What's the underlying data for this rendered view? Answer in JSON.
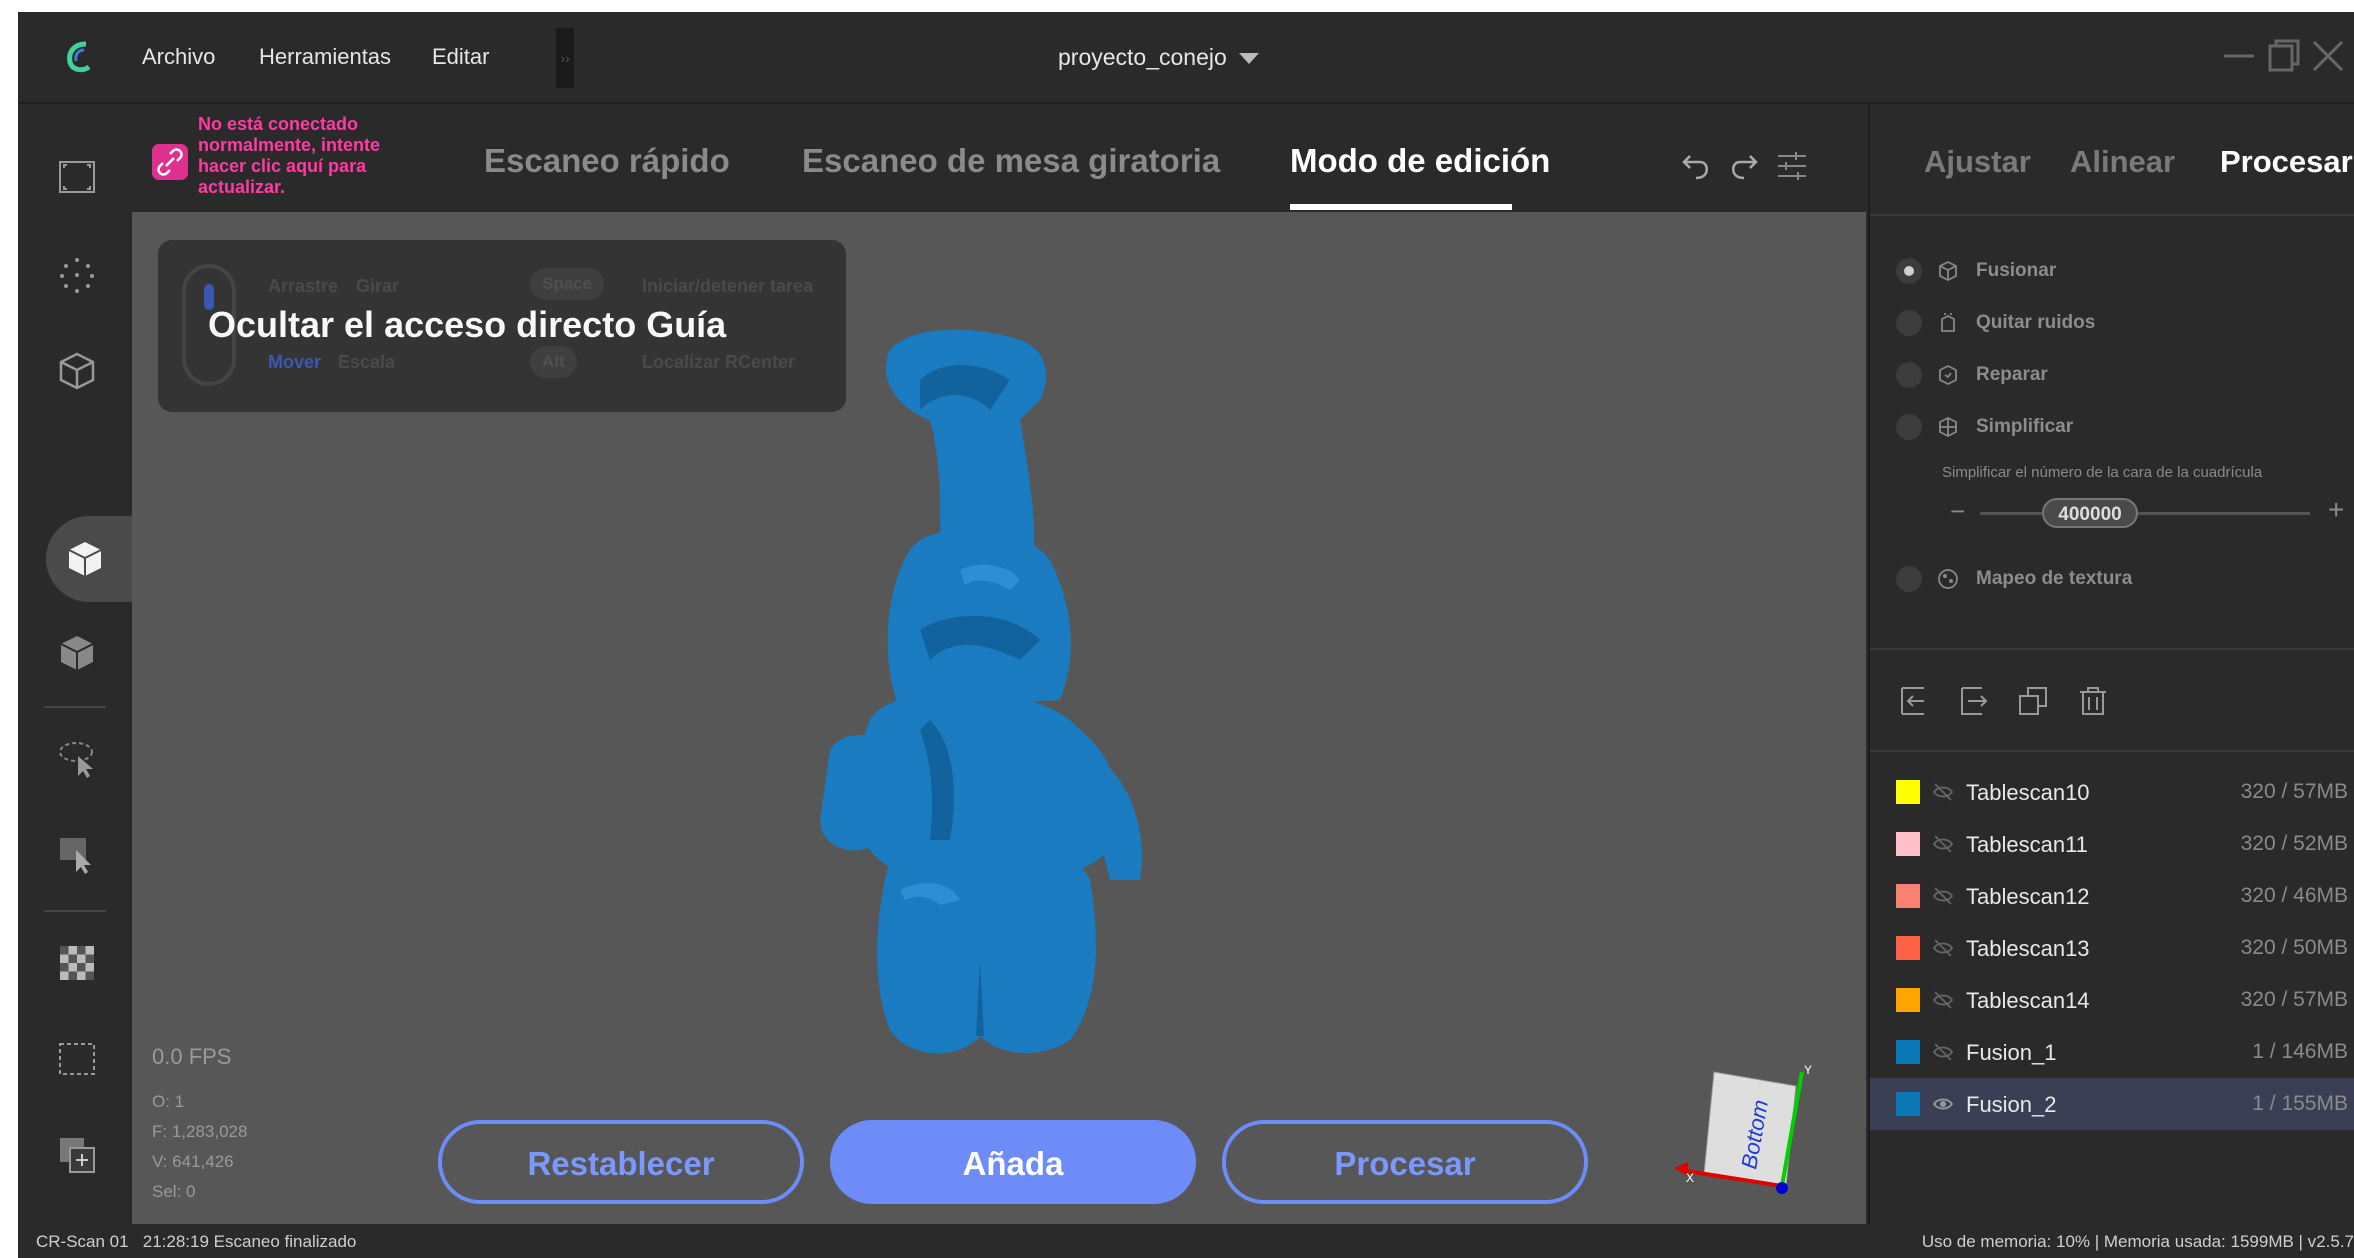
{
  "menu": {
    "archivo": "Archivo",
    "herramientas": "Herramientas",
    "editar": "Editar",
    "collapse": "››"
  },
  "project": {
    "name": "proyecto_conejo"
  },
  "connection": {
    "warning": "No está conectado normalmente, intente hacer clic aquí para actualizar."
  },
  "tabs": [
    {
      "label": "Escaneo rápido"
    },
    {
      "label": "Escaneo de mesa giratoria"
    },
    {
      "label": "Modo de edición"
    }
  ],
  "shortcut_guide": {
    "title": "Ocultar el acceso directo Guía",
    "drag": "Arrastre",
    "rotate": "Girar",
    "move": "Mover",
    "scale": "Escala",
    "space_key": "Space",
    "space_action": "Iniciar/detener tarea",
    "alt_key": "Alt",
    "alt_action": "Localizar RCenter"
  },
  "stats": {
    "fps": "0.0 FPS",
    "o": "O: 1",
    "f": "F: 1,283,028",
    "v": "V: 641,426",
    "sel": "Sel: 0"
  },
  "actions": {
    "reset": "Restablecer",
    "add": "Añada",
    "process": "Procesar"
  },
  "view_cube": {
    "face_label": "Bottom",
    "axis_x": "X",
    "axis_y": "Y"
  },
  "right_tabs": [
    {
      "label": "Ajustar"
    },
    {
      "label": "Alinear"
    },
    {
      "label": "Procesar"
    }
  ],
  "process_options": {
    "fuse": "Fusionar",
    "denoise": "Quitar ruidos",
    "repair": "Reparar",
    "simplify": "Simplificar",
    "simplify_desc": "Simplificar el número de la cara de la cuadrícula",
    "simplify_value": "400000",
    "slider_minus": "−",
    "slider_plus": "+",
    "texture": "Mapeo de textura"
  },
  "scans": [
    {
      "name": "Tablescan10",
      "info": "320 / 57MB",
      "color": "#ffff00"
    },
    {
      "name": "Tablescan11",
      "info": "320 / 52MB",
      "color": "#ffc0cb"
    },
    {
      "name": "Tablescan12",
      "info": "320 / 46MB",
      "color": "#fa8072"
    },
    {
      "name": "Tablescan13",
      "info": "320 / 50MB",
      "color": "#ff6347"
    },
    {
      "name": "Tablescan14",
      "info": "320 / 57MB",
      "color": "#ffa500"
    },
    {
      "name": "Fusion_1",
      "info": "1 / 146MB",
      "color": "#0a78b4"
    },
    {
      "name": "Fusion_2",
      "info": "1 / 155MB",
      "color": "#0a78b4"
    }
  ],
  "status": {
    "left": "CR-Scan 01   21:28:19 Escaneo finalizado",
    "right": "Uso de memoria: 10% | Memoria usada: 1599MB | v2.5.7"
  },
  "colors": {
    "accent": "#6d8cf7",
    "model": "#1a7bc0",
    "warning": "#ff3aa3"
  }
}
